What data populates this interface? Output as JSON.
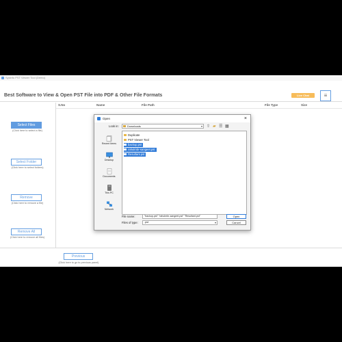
{
  "app": {
    "window_title": "Sysinfo PST Viewer Tool (Demo)",
    "headline": "Best Software to View & Open PST File into PDF & Other File Formats",
    "live_chat_label": "Live Chat",
    "menu_icon": "hamburger-icon",
    "brand_color": "#2d7bd6",
    "chat_color": "#f5a623"
  },
  "table": {
    "columns": [
      "S.No",
      "Name",
      "File Path",
      "File Type",
      "Size"
    ]
  },
  "left_panel": [
    {
      "label": "Select Files",
      "hint": "(Click here to select a file)"
    },
    {
      "label": "Select Folder",
      "hint": "(Click here to select folders)"
    },
    {
      "label": "Remove",
      "hint": "(Click here to remove a file)"
    },
    {
      "label": "Remove All",
      "hint": "(Click here to remove all files)"
    }
  ],
  "footer": {
    "previous_label": "Previous",
    "previous_hint": "(Click here to go to previous panel)"
  },
  "dialog": {
    "title": "Open",
    "look_in_label": "Look in:",
    "look_in_value": "Downloads",
    "places": [
      "Recent Items",
      "Desktop",
      "Documents",
      "This PC",
      "Network"
    ],
    "files": [
      {
        "name": "Duplicate",
        "type": "folder",
        "selected": false
      },
      {
        "name": "PST Viewer Tool",
        "type": "folder",
        "selected": false
      },
      {
        "name": "backup.pst",
        "type": "file",
        "selected": true
      },
      {
        "name": "rahulmbr-sangeet.pst",
        "type": "file",
        "selected": true
      },
      {
        "name": "Resultant.pst",
        "type": "file",
        "selected": true
      }
    ],
    "file_name_label": "File name:",
    "file_name_value": "\"backup.pst\" \"rahulmbr-sangeet.pst\" \"Resultant.pst\"",
    "file_type_label": "Files of type:",
    "file_type_value": ".pst",
    "open_label": "Open",
    "cancel_label": "Cancel"
  }
}
